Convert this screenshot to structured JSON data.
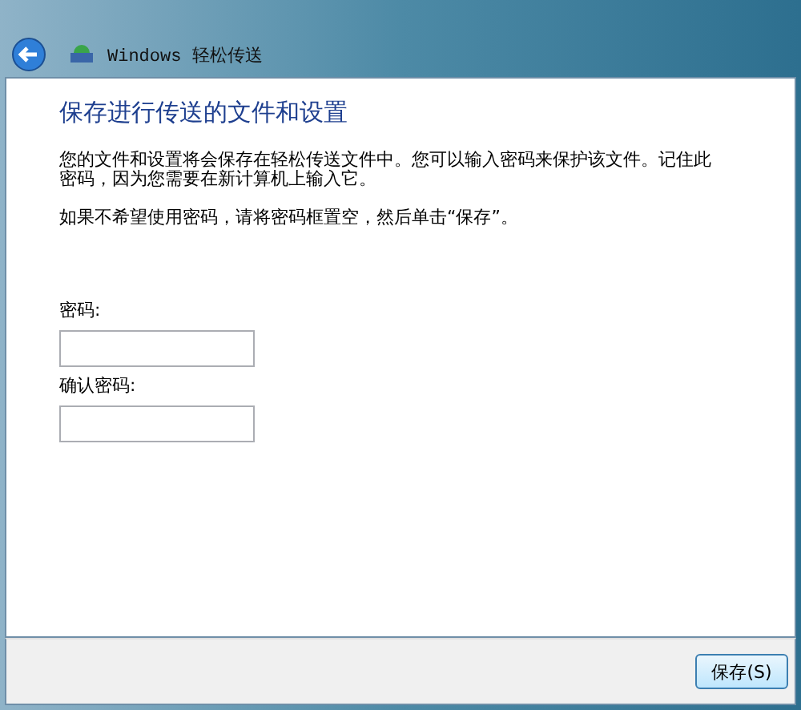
{
  "window": {
    "title": "Windows 轻松传送"
  },
  "heading": "保存进行传送的文件和设置",
  "paragraphs": [
    "您的文件和设置将会保存在轻松传送文件中。您可以输入密码来保护该文件。记住此密码，因为您需要在新计算机上输入它。",
    "如果不希望使用密码，请将密码框置空，然后单击“保存”。"
  ],
  "fields": [
    {
      "label": "密码:"
    },
    {
      "label": "确认密码:"
    }
  ],
  "buttons": [
    "保存(S)"
  ]
}
